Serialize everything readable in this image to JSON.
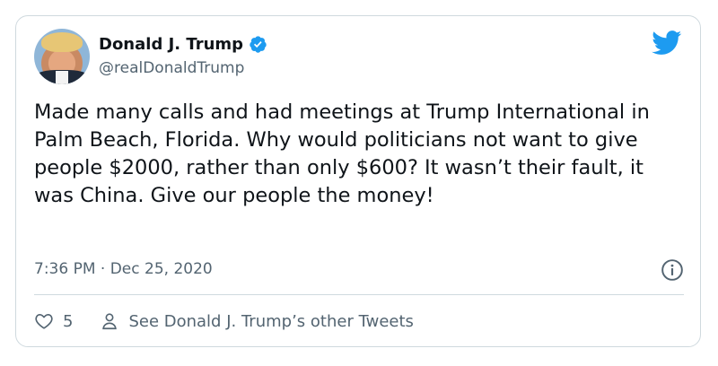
{
  "author": {
    "name": "Donald J. Trump",
    "handle": "@realDonaldTrump",
    "verified": true
  },
  "tweet": {
    "text": "Made many calls and had meetings at Trump International in Palm Beach, Florida. Why would politicians not want to give people $2000, rather than only $600? It wasn’t their fault, it was China. Give our people the money!",
    "timestamp": "7:36 PM · Dec 25, 2020"
  },
  "actions": {
    "like_count": "5",
    "other_tweets_label": "See Donald J. Trump’s other Tweets"
  },
  "colors": {
    "accent": "#1d9bf0",
    "muted": "#536471",
    "border": "#cfd9de"
  },
  "icons": {
    "brand": "twitter-bird-icon",
    "verified": "verified-badge-icon",
    "info": "info-icon",
    "like": "heart-icon",
    "profile": "person-icon"
  }
}
